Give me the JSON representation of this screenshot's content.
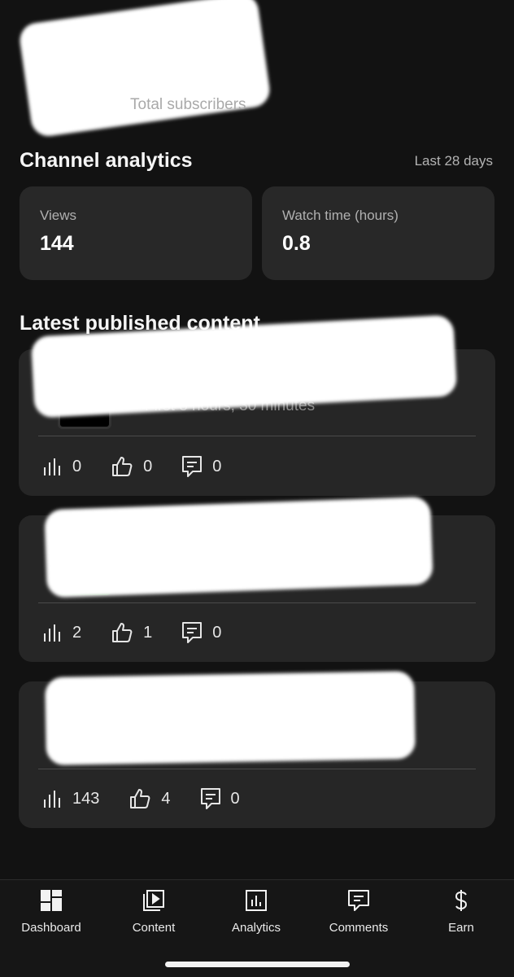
{
  "header": {
    "subscribers_label": "Total subscribers"
  },
  "analytics": {
    "title": "Channel analytics",
    "range": "Last 28 days",
    "cards": [
      {
        "label": "Views",
        "value": "144"
      },
      {
        "label": "Watch time (hours)",
        "value": "0.8"
      }
    ]
  },
  "latest": {
    "title": "Latest published content",
    "videos": [
      {
        "subtext": "First 8 hours, 30 minutes",
        "views": "0",
        "likes": "0",
        "comments": "0"
      },
      {
        "subtext": "",
        "views": "2",
        "likes": "1",
        "comments": "0"
      },
      {
        "subtext": "",
        "views": "143",
        "likes": "4",
        "comments": "0"
      }
    ]
  },
  "nav": [
    {
      "label": "Dashboard",
      "icon": "dashboard-icon"
    },
    {
      "label": "Content",
      "icon": "content-icon"
    },
    {
      "label": "Analytics",
      "icon": "analytics-icon"
    },
    {
      "label": "Comments",
      "icon": "comments-icon"
    },
    {
      "label": "Earn",
      "icon": "dollar-icon"
    }
  ]
}
